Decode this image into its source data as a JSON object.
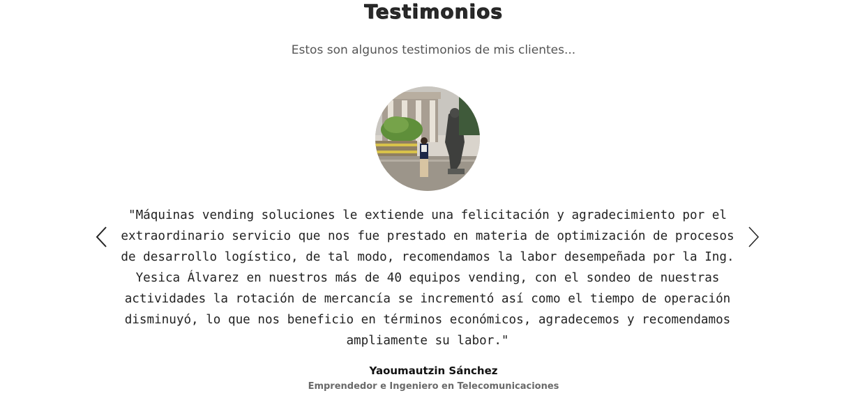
{
  "section": {
    "title": "Testimonios",
    "subtitle": "Estos son algunos testimonios de mis clientes..."
  },
  "testimonial": {
    "avatar_icon": "client-photo",
    "quote": "\"Máquinas vending soluciones le extiende una felicitación y agradecimiento por el extraordinario servicio que nos fue prestado en materia de optimización de procesos de desarrollo logístico, de tal modo, recomendamos la labor desempeñada por la Ing. Yesica Álvarez en nuestros más de 40 equipos vending, con el sondeo de nuestras actividades la rotación de mercancía se incrementó así como el tiempo de operación disminuyó, lo que nos beneficio en términos económicos, agradecemos y recomendamos ampliamente su labor.\"",
    "author": "Yaoumautzin Sánchez",
    "role": "Emprendedor e Ingeniero en Telecomunicaciones"
  },
  "controls": {
    "prev_icon": "chevron-left-icon",
    "next_icon": "chevron-right-icon"
  },
  "colors": {
    "text": "#222222",
    "subtitle": "#555555",
    "role": "#6a6a6a"
  }
}
